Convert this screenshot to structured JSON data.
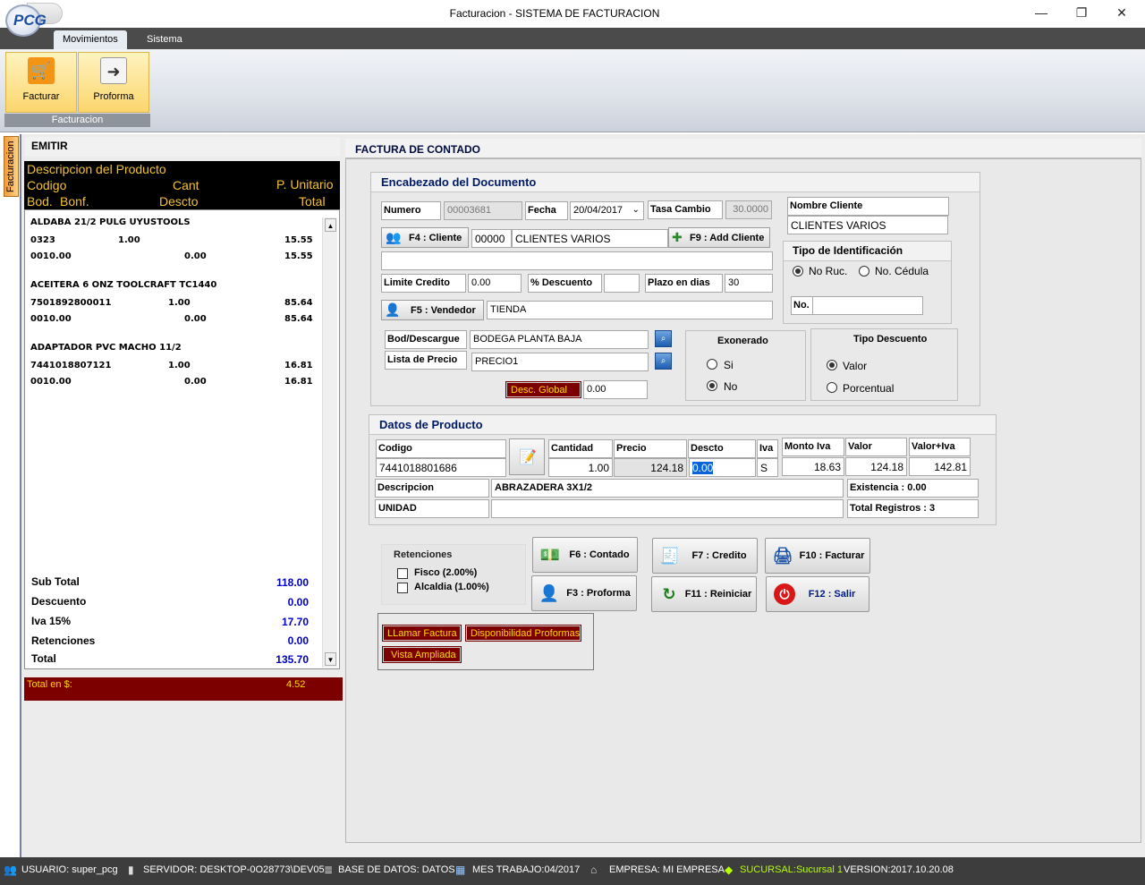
{
  "window": {
    "title": "Facturacion - SISTEMA DE FACTURACION",
    "logo_text": "PCG",
    "minimize": "—",
    "maximize": "❐",
    "close": "✕"
  },
  "ribbon": {
    "tabs": [
      "Movimientos",
      "Sistema"
    ],
    "buttons": [
      {
        "label": "Facturar",
        "icon": "cart-icon"
      },
      {
        "label": "Proforma",
        "icon": "document-arrow-icon"
      }
    ],
    "group": "Facturacion"
  },
  "sidetab": "Facturacion",
  "left": {
    "header": "EMITIR",
    "columns": {
      "c1": "Descripcion del Producto",
      "c2": "Codigo",
      "c3": "Cant",
      "c4": "P. Unitario",
      "c5": "Bod.",
      "c6": "Bonf.",
      "c7": "Descto",
      "c8": "Total"
    },
    "items": [
      {
        "desc": "ALDABA 21/2 PULG UYUSTOOLS",
        "code": "0323",
        "qty": "1.00",
        "price": "15.55",
        "bod": "001",
        "bonf": "0.00",
        "descto": "0.00",
        "total": "15.55"
      },
      {
        "desc": "ACEITERA 6 ONZ TOOLCRAFT TC1440",
        "code": "7501892800011",
        "qty": "1.00",
        "price": "85.64",
        "bod": "001",
        "bonf": "0.00",
        "descto": "0.00",
        "total": "85.64"
      },
      {
        "desc": "ADAPTADOR PVC  MACHO 11/2",
        "code": "7441018807121",
        "qty": "1.00",
        "price": "16.81",
        "bod": "001",
        "bonf": "0.00",
        "descto": "0.00",
        "total": "16.81"
      }
    ],
    "totals": [
      {
        "label": "Sub Total",
        "value": "118.00"
      },
      {
        "label": "Descuento",
        "value": "0.00"
      },
      {
        "label": "Iva 15%",
        "value": "17.70"
      },
      {
        "label": "Retenciones",
        "value": "0.00"
      },
      {
        "label": "Total",
        "value": "135.70"
      }
    ],
    "total_usd_label": "Total en $:",
    "total_usd_value": "4.52"
  },
  "factura": {
    "header": "FACTURA DE CONTADO",
    "enc": {
      "title": "Encabezado del Documento",
      "numero_label": "Numero",
      "numero": "00003681",
      "fecha_label": "Fecha",
      "fecha": "20/04/2017",
      "tasa_label": "Tasa Cambio",
      "tasa": "30.0000",
      "nombre_label": "Nombre Cliente",
      "nombre": "CLIENTES VARIOS",
      "f4": "F4 : Cliente",
      "cliente_code": "00000",
      "cliente_name": "CLIENTES VARIOS",
      "f9": "F9 : Add Cliente",
      "tipo_id_title": "Tipo de Identificación",
      "no_ruc": "No Ruc.",
      "no_cedula": "No. Cédula",
      "no_label": "No.",
      "limite_label": "Limite Credito",
      "limite": "0.00",
      "desc_label": "% Descuento",
      "desc": "",
      "plazo_label": "Plazo en dias",
      "plazo": "30",
      "f5": "F5 : Vendedor",
      "vendedor": "TIENDA",
      "bod_label": "Bod/Descargue",
      "bod": "BODEGA PLANTA BAJA",
      "lista_label": "Lista de Precio",
      "lista": "PRECIO1",
      "desc_global_label": "Desc. Global",
      "desc_global": "0.00",
      "exonerado_title": "Exonerado",
      "si": "Si",
      "no": "No",
      "tipo_desc_title": "Tipo Descuento",
      "valor": "Valor",
      "porcentual": "Porcentual"
    },
    "producto": {
      "title": "Datos de Producto",
      "codigo_label": "Codigo",
      "codigo": "7441018801686",
      "cantidad_label": "Cantidad",
      "cantidad": "1.00",
      "precio_label": "Precio",
      "precio": "124.18",
      "descto_label": "Descto",
      "descto": "0.00",
      "iva_label": "Iva",
      "iva": "S",
      "monto_iva_label": "Monto Iva",
      "monto_iva": "18.63",
      "valor_label": "Valor",
      "valor": "124.18",
      "valor_iva_label": "Valor+Iva",
      "valor_iva": "142.81",
      "descripcion_label": "Descripcion",
      "descripcion": "ABRAZADERA 3X1/2",
      "existencia": "Existencia : 0.00",
      "unidad": "UNIDAD",
      "total_registros": "Total Registros : 3"
    },
    "retenciones": {
      "title": "Retenciones",
      "fisco": "Fisco (2.00%)",
      "alcaldia": "Alcaldia (1.00%)"
    },
    "actions": {
      "f6": "F6 : Contado",
      "f7": "F7 : Credito",
      "f10": "F10 : Facturar",
      "f3": "F3 : Proforma",
      "f11": "F11 : Reiniciar",
      "f12": "F12 : Salir"
    },
    "links": {
      "llamar": "LLamar Factura",
      "disponibilidad": "Disponibilidad Proformas",
      "vista": "Vista Ampliada"
    }
  },
  "status": {
    "usuario": "USUARIO:  super_pcg",
    "servidor": "SERVIDOR:  DESKTOP-0O28773\\DEV05",
    "base": "BASE DE DATOS:  DATOS",
    "mes": "MES TRABAJO:04/2017",
    "empresa": "EMPRESA:  MI EMPRESA",
    "sucursal": "SUCURSAL:Sucursal 1",
    "version": "VERSION:2017.10.20.08"
  },
  "colors": {
    "accent_red": "#7c0000",
    "accent_yellow": "#ffd800",
    "total_blue": "#0000c0",
    "sucursal_green": "#b6ff00"
  }
}
